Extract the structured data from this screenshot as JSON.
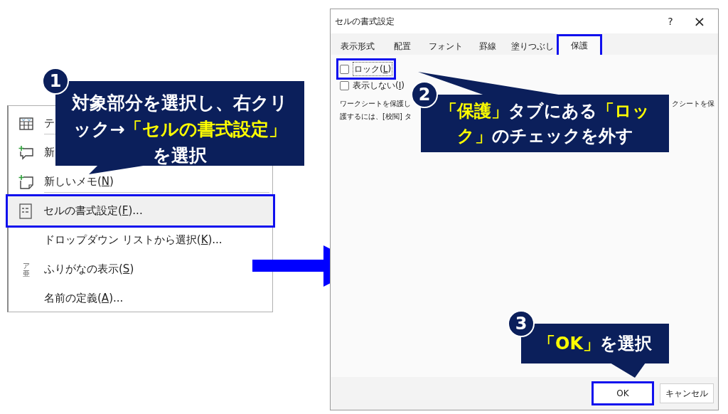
{
  "context_menu": {
    "items": [
      {
        "kind": "table",
        "before": "テ",
        "selected": false,
        "separator_after": true
      },
      {
        "kind": "comment",
        "before": "新",
        "selected": false,
        "separator_after": false
      },
      {
        "kind": "note",
        "before": "新しいメモ(",
        "key": "N",
        "after": ")",
        "selected": false,
        "separator_after": true
      },
      {
        "kind": "format",
        "before": "セルの書式設定(",
        "key": "F",
        "after": ")...",
        "selected": true,
        "separator_after": false
      },
      {
        "kind": "none",
        "before": "ドロップダウン リストから選択(",
        "key": "K",
        "after": ")...",
        "selected": false,
        "separator_after": false
      },
      {
        "kind": "furigana",
        "icon_text": [
          "ア",
          "亜"
        ],
        "before": "ふりがなの表示(",
        "key": "S",
        "after": ")",
        "selected": false,
        "separator_after": false
      },
      {
        "kind": "none",
        "before": "名前の定義(",
        "key": "A",
        "after": ")...",
        "selected": false,
        "separator_after": false
      }
    ]
  },
  "dialog": {
    "title": "セルの書式設定",
    "help": "?",
    "close": "×",
    "tabs": [
      {
        "label": "表示形式",
        "selected": false
      },
      {
        "label": "配置",
        "selected": false
      },
      {
        "label": "フォント",
        "selected": false
      },
      {
        "label": "罫線",
        "selected": false
      },
      {
        "label": "塗りつぶし",
        "selected": false
      },
      {
        "label": "保護",
        "selected": true
      }
    ],
    "checkboxes": [
      {
        "before": "ロック(",
        "key": "L",
        "after": ")",
        "checked": false,
        "focused": true
      },
      {
        "before": "表示しない(",
        "key": "I",
        "after": ")",
        "checked": false,
        "focused": false
      }
    ],
    "description": {
      "left_lines": [
        "ワークシートを保護し",
        "護するには、[校閲] タ"
      ],
      "right_line": "クシートを保"
    },
    "buttons": [
      {
        "label": "OK",
        "kind": "primary"
      },
      {
        "label": "キャンセル",
        "kind": "secondary"
      }
    ]
  },
  "callouts": [
    {
      "number": "1",
      "lines": [
        [
          {
            "text": "対象部分を選択し、右クリ",
            "highlight": false
          }
        ],
        [
          {
            "text": "ック→",
            "highlight": false
          },
          {
            "text": "「セルの書式設定」",
            "highlight": true
          }
        ],
        [
          {
            "text": "を選択",
            "highlight": false
          }
        ]
      ]
    },
    {
      "number": "2",
      "lines": [
        [
          {
            "text": "「保護」",
            "highlight": true
          },
          {
            "text": "タブにある",
            "highlight": false
          },
          {
            "text": "「ロッ",
            "highlight": true
          }
        ],
        [
          {
            "text": "ク」",
            "highlight": true
          },
          {
            "text": "のチェックを外す",
            "highlight": false
          }
        ]
      ]
    },
    {
      "number": "3",
      "lines": [
        [
          {
            "text": "「OK」",
            "highlight": true
          },
          {
            "text": "を選択",
            "highlight": false
          }
        ]
      ]
    }
  ]
}
